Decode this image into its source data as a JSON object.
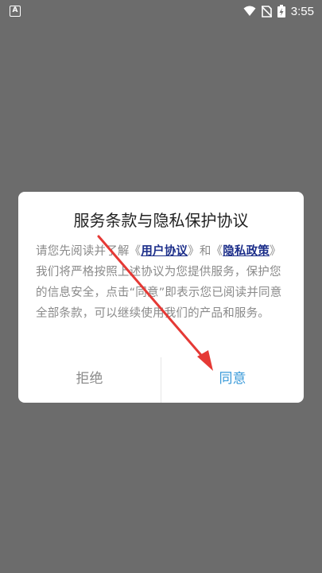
{
  "status_bar": {
    "notification_icon_letter": "A",
    "time": "3:55",
    "icons": [
      "wifi-icon",
      "no-sim-icon",
      "battery-charging-icon"
    ]
  },
  "dialog": {
    "title": "服务条款与隐私保护协议",
    "body_prefix": "请您先阅读并了解《",
    "link_user_agreement": "用户协议",
    "body_middle": "》和《",
    "link_privacy_policy": "隐私政策",
    "body_suffix": "》我们将严格按照上述协议为您提供服务，保护您的信息安全，点击“同意”即表示您已阅读并同意全部条款，可以继续使用我们的产品和服务。",
    "reject_label": "拒绝",
    "agree_label": "同意"
  },
  "colors": {
    "backdrop": "#6c6c6c",
    "link": "#1c2e8a",
    "agree": "#3a9ad9",
    "arrow": "#e53935"
  }
}
